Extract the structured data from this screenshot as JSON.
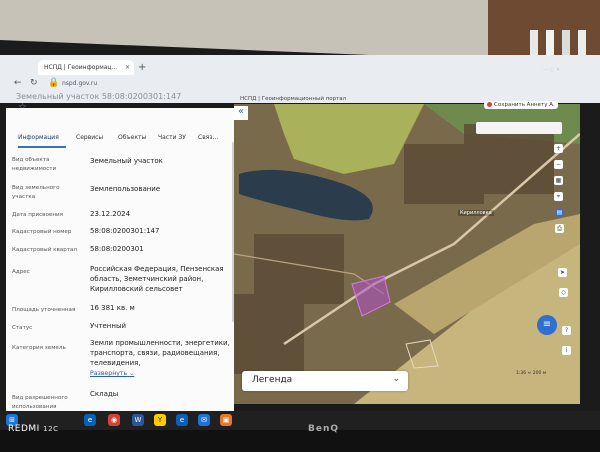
{
  "browser": {
    "tab_title": "НСПД | Геоинформац...",
    "url": "nspd.gov.ru",
    "page_title": "НСПД | Геоинформационный портал"
  },
  "sidebar": {
    "header_partial": "Земельный участок 58:08:0200301:147",
    "tabs": [
      {
        "label": "Информация"
      },
      {
        "label": "Сервисы"
      },
      {
        "label": "Объекты"
      },
      {
        "label": "Части ЗУ"
      },
      {
        "label": "Связ..."
      }
    ],
    "fields": [
      {
        "label": "Вид объекта недвижимости",
        "value": "Земельный участок"
      },
      {
        "label": "Вид земельного участка",
        "value": "Землепользование"
      },
      {
        "label": "Дата присвоения",
        "value": "23.12.2024"
      },
      {
        "label": "Кадастровый номер",
        "value": "58:08:0200301:147"
      },
      {
        "label": "Кадастровый квартал",
        "value": "58:08:0200301"
      },
      {
        "label": "Адрес",
        "value": "Российская Федерация, Пензенская область, Земетчинский район, Кирилловский сельсовет"
      },
      {
        "label": "Площадь уточненная",
        "value": "16 381 кв. м"
      },
      {
        "label": "Статус",
        "value": "Учтенный"
      },
      {
        "label": "Категория земель",
        "value": "Земли промышленности, энергетики, транспорта, связи, радиовещания, телевидения,"
      },
      {
        "label": "Вид разрешенного использования",
        "value": "Склады"
      }
    ],
    "expand_label": "Развернуть"
  },
  "map": {
    "share_label": "Сохранить Аннету А.",
    "legend_label": "Легенда",
    "place_label": "Кирилловка",
    "scale_text": "1:36 ≈ 200 м"
  },
  "monitor": {
    "brand": "BenQ",
    "watermark": "REDMI",
    "watermark_model": "12C"
  },
  "colors": {
    "accent": "#3b6fb6",
    "parcel": "#b04ec8",
    "water": "#2b3d4d",
    "field": "#c9b87a"
  }
}
